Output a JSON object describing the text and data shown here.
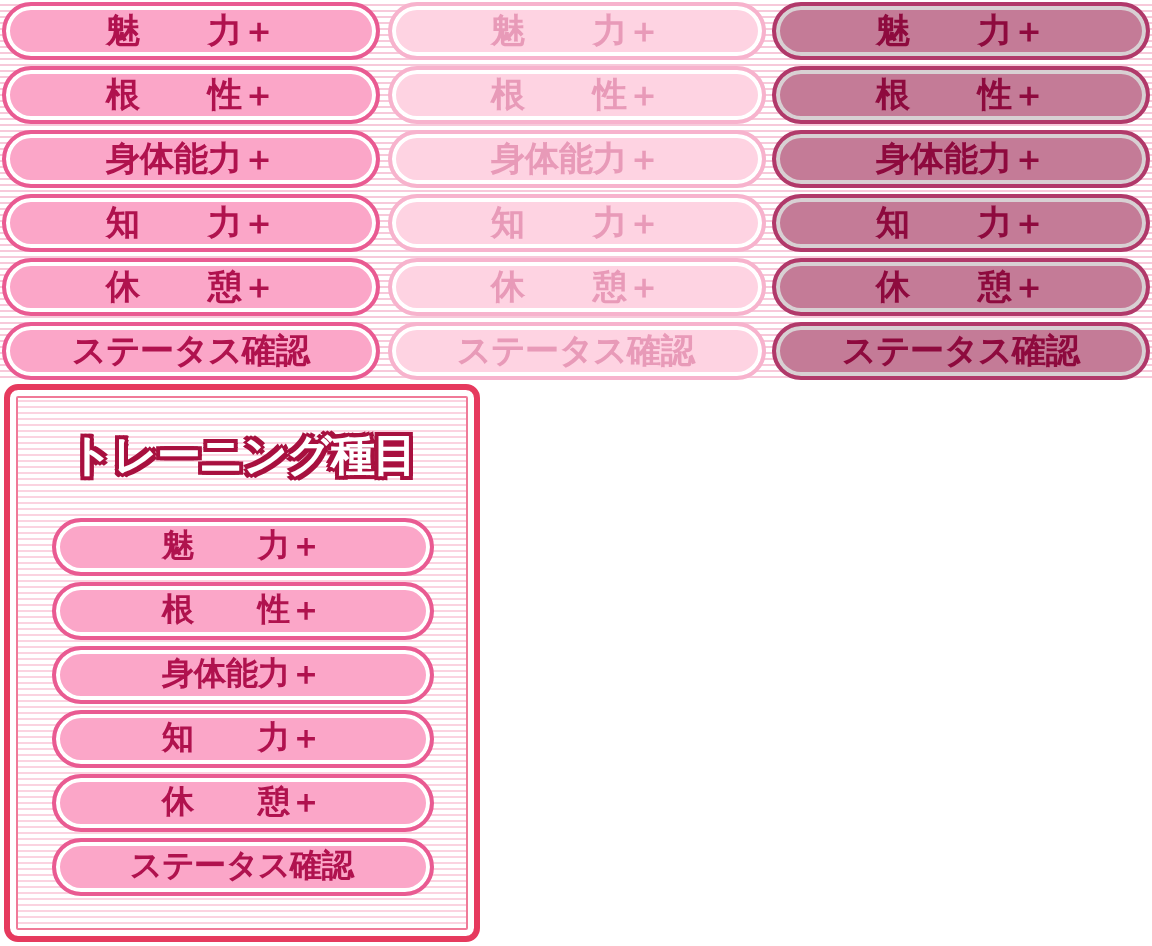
{
  "button_sets": [
    {
      "kind": "normal",
      "buttons": [
        "魅　　力＋",
        "根　　性＋",
        "身体能力＋",
        "知　　力＋",
        "休　　憩＋",
        "ステータス確認"
      ]
    },
    {
      "kind": "disabled",
      "buttons": [
        "魅　　力＋",
        "根　　性＋",
        "身体能力＋",
        "知　　力＋",
        "休　　憩＋",
        "ステータス確認"
      ]
    },
    {
      "kind": "pressed",
      "buttons": [
        "魅　　力＋",
        "根　　性＋",
        "身体能力＋",
        "知　　力＋",
        "休　　憩＋",
        "ステータス確認"
      ]
    }
  ],
  "panel": {
    "title": "トレーニング種目",
    "buttons": [
      "魅　　力＋",
      "根　　性＋",
      "身体能力＋",
      "知　　力＋",
      "休　　憩＋",
      "ステータス確認"
    ]
  }
}
